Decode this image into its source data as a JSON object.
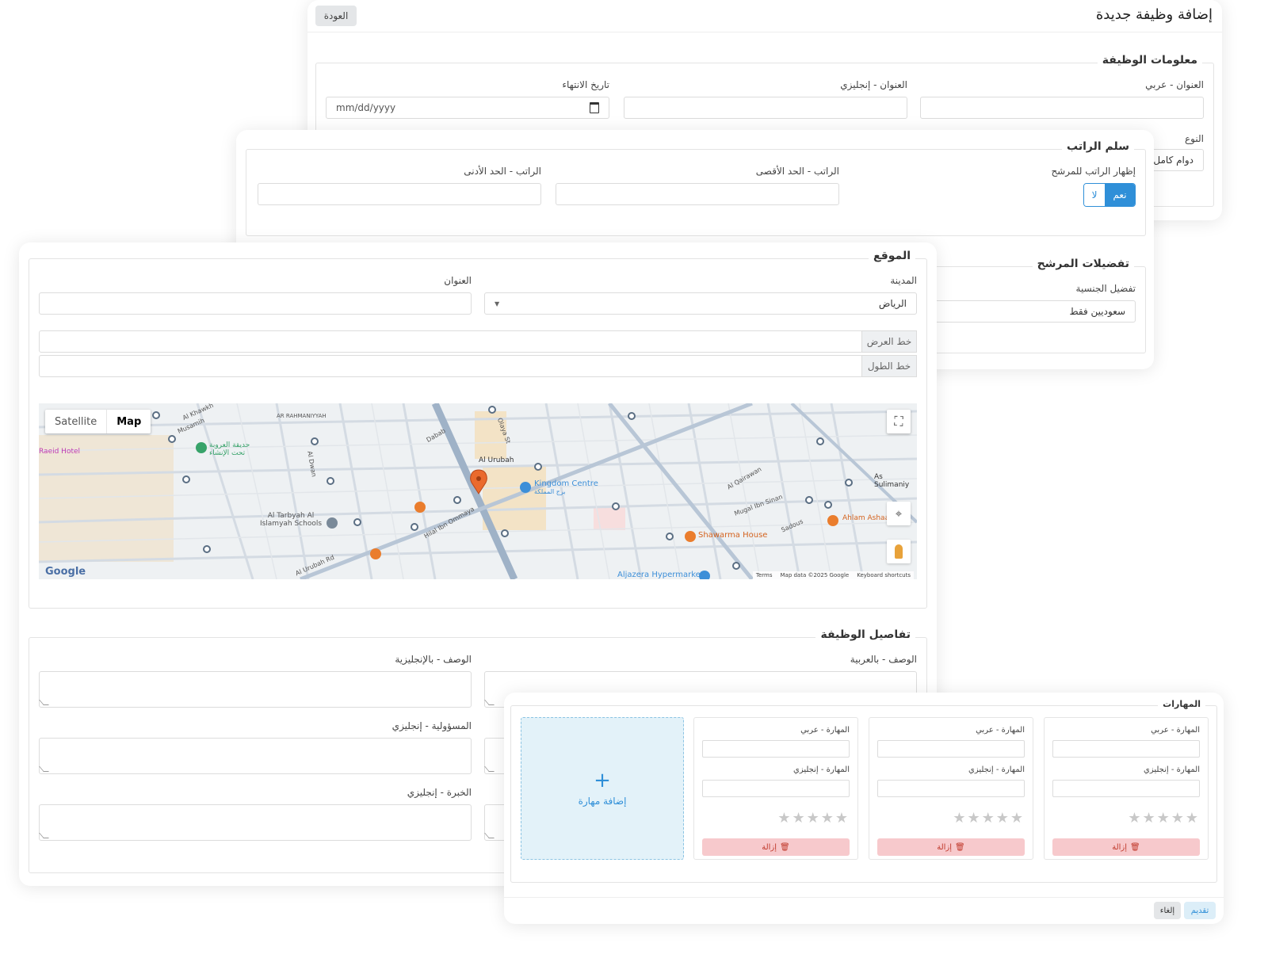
{
  "header": {
    "title": "إضافة وظيفة جديدة",
    "back_label": "العودة"
  },
  "job_info": {
    "legend": "معلومات الوظيفة",
    "title_ar_label": "العنوان - عربي",
    "title_en_label": "العنوان - إنجليزي",
    "expiry_label": "تاريخ الانتهاء",
    "expiry_placeholder": "mm/dd/yyyy",
    "type_label": "النوع",
    "type_value": "دوام كامل"
  },
  "salary": {
    "legend": "سلم الراتب",
    "show_label": "إظهار الراتب للمرشح",
    "yes": "نعم",
    "no": "لا",
    "max_label": "الراتب - الحد الأقصى",
    "min_label": "الراتب - الحد الأدنى"
  },
  "preferences": {
    "legend": "تفضيلات المرشح",
    "nationality_label": "تفضيل الجنسية",
    "nationality_value": "سعوديين فقط"
  },
  "location": {
    "legend": "الموقع",
    "city_label": "المدينة",
    "city_value": "الرياض",
    "address_label": "العنوان",
    "lat_label": "خط العرض",
    "lng_label": "خط الطول",
    "map": {
      "satellite_label": "Satellite",
      "map_label": "Map",
      "google_label": "Google",
      "footer_terms": "Terms",
      "footer_data": "Map data ©2025 Google",
      "footer_shortcuts": "Keyboard shortcuts",
      "places": [
        "Kingdom Centre",
        "برج المملكة",
        "Al Urubah",
        "Shawarma House",
        "Aljazera Hypermarket",
        "As Sulimaniy",
        "Ahlam Ashaa",
        "Al Tarbyah Al Islamyah Schools",
        "حديقة العروبة تحت الإنشاء",
        "Olaya St",
        "Al Urubah Rd",
        "Hilal Ibn Ommaya",
        "Dabab",
        "Al Qairawan",
        "Mugal Ibn Sinan",
        "Sadous",
        "Al Khawkh",
        "Musamih",
        "AR RAHMANIYYAH",
        "Al Dwan",
        "Raeid Hotel"
      ]
    }
  },
  "details": {
    "legend": "تفاصيل الوظيفة",
    "desc_ar_label": "الوصف - بالعربية",
    "desc_en_label": "الوصف - بالإنجليزية",
    "resp_en_label": "المسؤولية - إنجليزي",
    "exp_en_label": "الخبرة - إنجليزي"
  },
  "skills": {
    "legend": "المهارات",
    "skill_ar_label": "المهارة - عربي",
    "skill_en_label": "المهارة - إنجليزي",
    "remove_label": "إزالة",
    "add_label": "إضافة مهارة",
    "stars": "★★★★★"
  },
  "footer": {
    "submit_label": "تقديم",
    "cancel_label": "إلغاء"
  },
  "colors": {
    "primary": "#2f8fd8",
    "danger_bg": "#f7c9cc",
    "map_road": "#b8c6d6",
    "pin": "#ea6a2d"
  }
}
